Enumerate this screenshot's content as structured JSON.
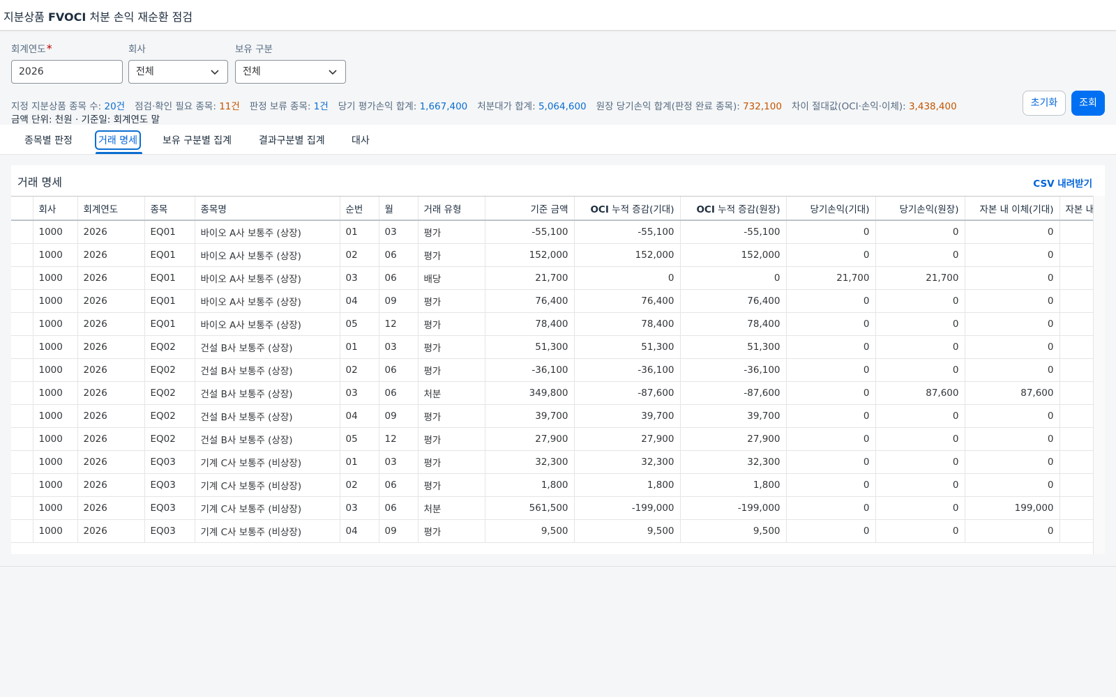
{
  "title": {
    "prefix": "지분상품 ",
    "strong": "FVOCI",
    "suffix": " 처분 손익 재순환 점검"
  },
  "filters": {
    "year": {
      "label": "회계연도",
      "required_mark": "*",
      "value": "2026"
    },
    "company": {
      "label": "회사",
      "value": "전체"
    },
    "holding": {
      "label": "보유 구분",
      "value": "전체"
    }
  },
  "buttons": {
    "reset": "초기화",
    "search": "조회"
  },
  "summary": [
    {
      "label": "지정 지분상품 종목 수: ",
      "value": "20건",
      "color": "#0a6ed1"
    },
    {
      "label": "점검·확인 필요 종목: ",
      "value": "11건",
      "color": "#c35500"
    },
    {
      "label": "판정 보류 종목: ",
      "value": "1건",
      "color": "#0a6ed1"
    },
    {
      "label": "당기 평가손익 합계: ",
      "value": "1,667,400",
      "color": "#0a6ed1"
    },
    {
      "label": "처분대가 합계: ",
      "value": "5,064,600",
      "color": "#0a6ed1"
    },
    {
      "label": "원장 당기손익 합계(판정 완료 종목): ",
      "value": "732,100",
      "color": "#c35500"
    },
    {
      "label": "차이 절대값(OCI·손익·이체): ",
      "value": "3,438,400",
      "color": "#c35500"
    }
  ],
  "unit_note": "금액 단위: 천원 · 기준일: 회계연도 말",
  "tabs": [
    "종목별 판정",
    "거래 명세",
    "보유 구분별 집계",
    "결과구분별 집계",
    "대사"
  ],
  "selected_tab": "거래 명세",
  "panel": {
    "title": "거래 명세",
    "csv_label": "CSV 내려받기"
  },
  "table": {
    "columns": [
      "회사",
      "회계연도",
      "종목",
      "종목명",
      "순번",
      "월",
      "거래 유형",
      "기준 금액",
      "OCI 누적 증감(기대)",
      "OCI 누적 증감(원장)",
      "당기손익(기대)",
      "당기손익(원장)",
      "자본 내 이체(기대)",
      "자본 내"
    ],
    "rows": [
      [
        "1000",
        "2026",
        "EQ01",
        "바이오 A사 보통주 (상장)",
        "01",
        "03",
        "평가",
        "-55,100",
        "-55,100",
        "-55,100",
        "0",
        "0",
        "0",
        ""
      ],
      [
        "1000",
        "2026",
        "EQ01",
        "바이오 A사 보통주 (상장)",
        "02",
        "06",
        "평가",
        "152,000",
        "152,000",
        "152,000",
        "0",
        "0",
        "0",
        ""
      ],
      [
        "1000",
        "2026",
        "EQ01",
        "바이오 A사 보통주 (상장)",
        "03",
        "06",
        "배당",
        "21,700",
        "0",
        "0",
        "21,700",
        "21,700",
        "0",
        ""
      ],
      [
        "1000",
        "2026",
        "EQ01",
        "바이오 A사 보통주 (상장)",
        "04",
        "09",
        "평가",
        "76,400",
        "76,400",
        "76,400",
        "0",
        "0",
        "0",
        ""
      ],
      [
        "1000",
        "2026",
        "EQ01",
        "바이오 A사 보통주 (상장)",
        "05",
        "12",
        "평가",
        "78,400",
        "78,400",
        "78,400",
        "0",
        "0",
        "0",
        ""
      ],
      [
        "1000",
        "2026",
        "EQ02",
        "건설 B사 보통주 (상장)",
        "01",
        "03",
        "평가",
        "51,300",
        "51,300",
        "51,300",
        "0",
        "0",
        "0",
        ""
      ],
      [
        "1000",
        "2026",
        "EQ02",
        "건설 B사 보통주 (상장)",
        "02",
        "06",
        "평가",
        "-36,100",
        "-36,100",
        "-36,100",
        "0",
        "0",
        "0",
        ""
      ],
      [
        "1000",
        "2026",
        "EQ02",
        "건설 B사 보통주 (상장)",
        "03",
        "06",
        "처분",
        "349,800",
        "-87,600",
        "-87,600",
        "0",
        "87,600",
        "87,600",
        ""
      ],
      [
        "1000",
        "2026",
        "EQ02",
        "건설 B사 보통주 (상장)",
        "04",
        "09",
        "평가",
        "39,700",
        "39,700",
        "39,700",
        "0",
        "0",
        "0",
        ""
      ],
      [
        "1000",
        "2026",
        "EQ02",
        "건설 B사 보통주 (상장)",
        "05",
        "12",
        "평가",
        "27,900",
        "27,900",
        "27,900",
        "0",
        "0",
        "0",
        ""
      ],
      [
        "1000",
        "2026",
        "EQ03",
        "기계 C사 보통주 (비상장)",
        "01",
        "03",
        "평가",
        "32,300",
        "32,300",
        "32,300",
        "0",
        "0",
        "0",
        ""
      ],
      [
        "1000",
        "2026",
        "EQ03",
        "기계 C사 보통주 (비상장)",
        "02",
        "06",
        "평가",
        "1,800",
        "1,800",
        "1,800",
        "0",
        "0",
        "0",
        ""
      ],
      [
        "1000",
        "2026",
        "EQ03",
        "기계 C사 보통주 (비상장)",
        "03",
        "06",
        "처분",
        "561,500",
        "-199,000",
        "-199,000",
        "0",
        "0",
        "199,000",
        ""
      ],
      [
        "1000",
        "2026",
        "EQ03",
        "기계 C사 보통주 (비상장)",
        "04",
        "09",
        "평가",
        "9,500",
        "9,500",
        "9,500",
        "0",
        "0",
        "0",
        ""
      ]
    ]
  },
  "icons": {
    "dropdown": "chevron-down-icon"
  }
}
